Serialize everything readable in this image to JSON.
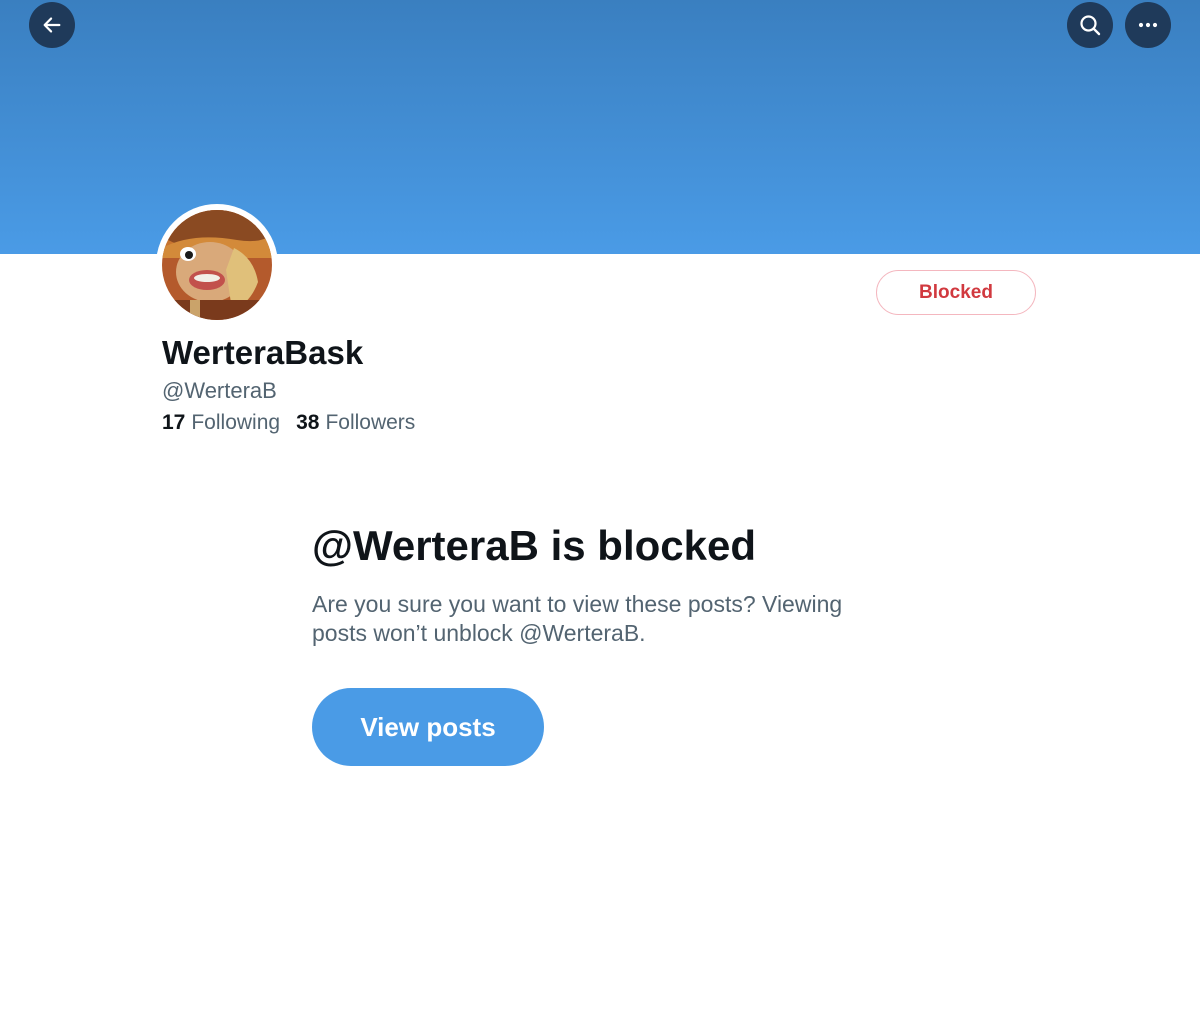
{
  "header": {
    "back_icon": "arrow-left-icon",
    "search_icon": "search-icon",
    "more_icon": "more-horizontal-icon",
    "banner_color": "#4a9be6",
    "button_bg": "#1f3a5a"
  },
  "profile": {
    "display_name": "WerteraBask",
    "handle": "@WerteraB",
    "following_count": "17",
    "following_label": "Following",
    "followers_count": "38",
    "followers_label": "Followers",
    "blocked_label": "Blocked",
    "blocked_color": "#d1393f"
  },
  "block_notice": {
    "title": "@WerteraB is blocked",
    "description": "Are you sure you want to view these posts? Viewing posts won’t unblock @WerteraB.",
    "view_posts_label": "View posts",
    "accent_color": "#4a9be6"
  }
}
